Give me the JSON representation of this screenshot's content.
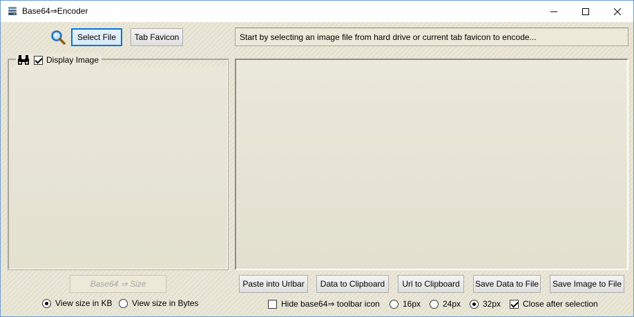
{
  "window": {
    "title": "Base64⇒Encoder",
    "minimize_glyph": "—",
    "maximize_glyph": "☐",
    "close_glyph": "✕"
  },
  "toolbar": {
    "select_file_label": "Select File",
    "tab_favicon_label": "Tab Favicon",
    "search_icon": "magnifier-icon"
  },
  "status": {
    "message": "Start by selecting an image file from hard drive or current tab favicon to encode..."
  },
  "image_group": {
    "display_image_label": "Display Image",
    "display_image_checked": true,
    "icon": "binoculars-icon"
  },
  "size": {
    "button_label": "Base64 ⇒ Size",
    "view_kb_label": "View size in KB",
    "view_bytes_label": "View size in Bytes",
    "selected": "kb"
  },
  "actions": {
    "paste_urlbar": "Paste into Urlbar",
    "data_clipboard": "Data to Clipboard",
    "url_clipboard": "Url to Clipboard",
    "save_data": "Save Data to File",
    "save_image": "Save Image to File"
  },
  "options": {
    "hide_icon_label": "Hide base64⇒ toolbar icon",
    "px16": "16px",
    "px24": "24px",
    "px32": "32px",
    "selected_size": "32px",
    "close_after_label": "Close after selection",
    "close_after_checked": true,
    "hide_icon_checked": false
  }
}
